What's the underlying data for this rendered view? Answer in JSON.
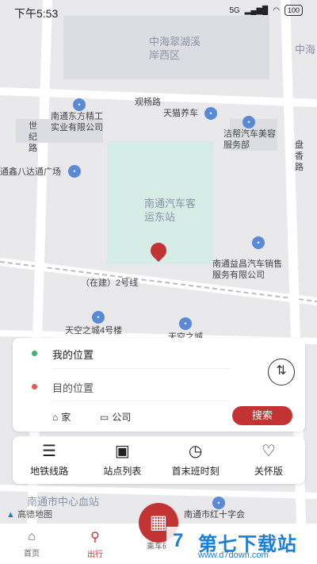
{
  "status_bar": {
    "time": "下午5:53",
    "signal": "5G",
    "battery": "100"
  },
  "map": {
    "area_labels": [
      "中海翠湖溪岸西区",
      "中海",
      "观畅路",
      "南通东方精工实业有限公司",
      "天猫养车",
      "洁帮汽车美容服务部",
      "世纪路",
      "盘香路",
      "通鑫八达通广场",
      "南通汽车客运东站",
      "南通益昌汽车销售服务有限公司",
      "（在建）2号线",
      "天空之城4号楼",
      "天空之城",
      "南通市中心血站",
      "南通市红十字会"
    ],
    "brand": "高德地图"
  },
  "route_card": {
    "origin": "我的位置",
    "destination": "目的位置",
    "home_label": "家",
    "company_label": "公司",
    "search_label": "搜索",
    "origin_color": "#3cb371",
    "destination_color": "#e05a4f"
  },
  "tools": [
    {
      "label": "地铁线路",
      "icon": "sliders-icon"
    },
    {
      "label": "站点列表",
      "icon": "list-frame-icon"
    },
    {
      "label": "首末班时刻",
      "icon": "clock-icon"
    },
    {
      "label": "关怀版",
      "icon": "heart-icon"
    }
  ],
  "nav": {
    "items": [
      "首页",
      "出行",
      "乘车码",
      "",
      ""
    ],
    "active": "出行"
  },
  "watermark": {
    "title": "第七下载站",
    "url": "www.d7down.com"
  },
  "colors": {
    "accent": "#c33333",
    "map_bg": "#e9e9ec",
    "station_area": "#d6ece6"
  }
}
